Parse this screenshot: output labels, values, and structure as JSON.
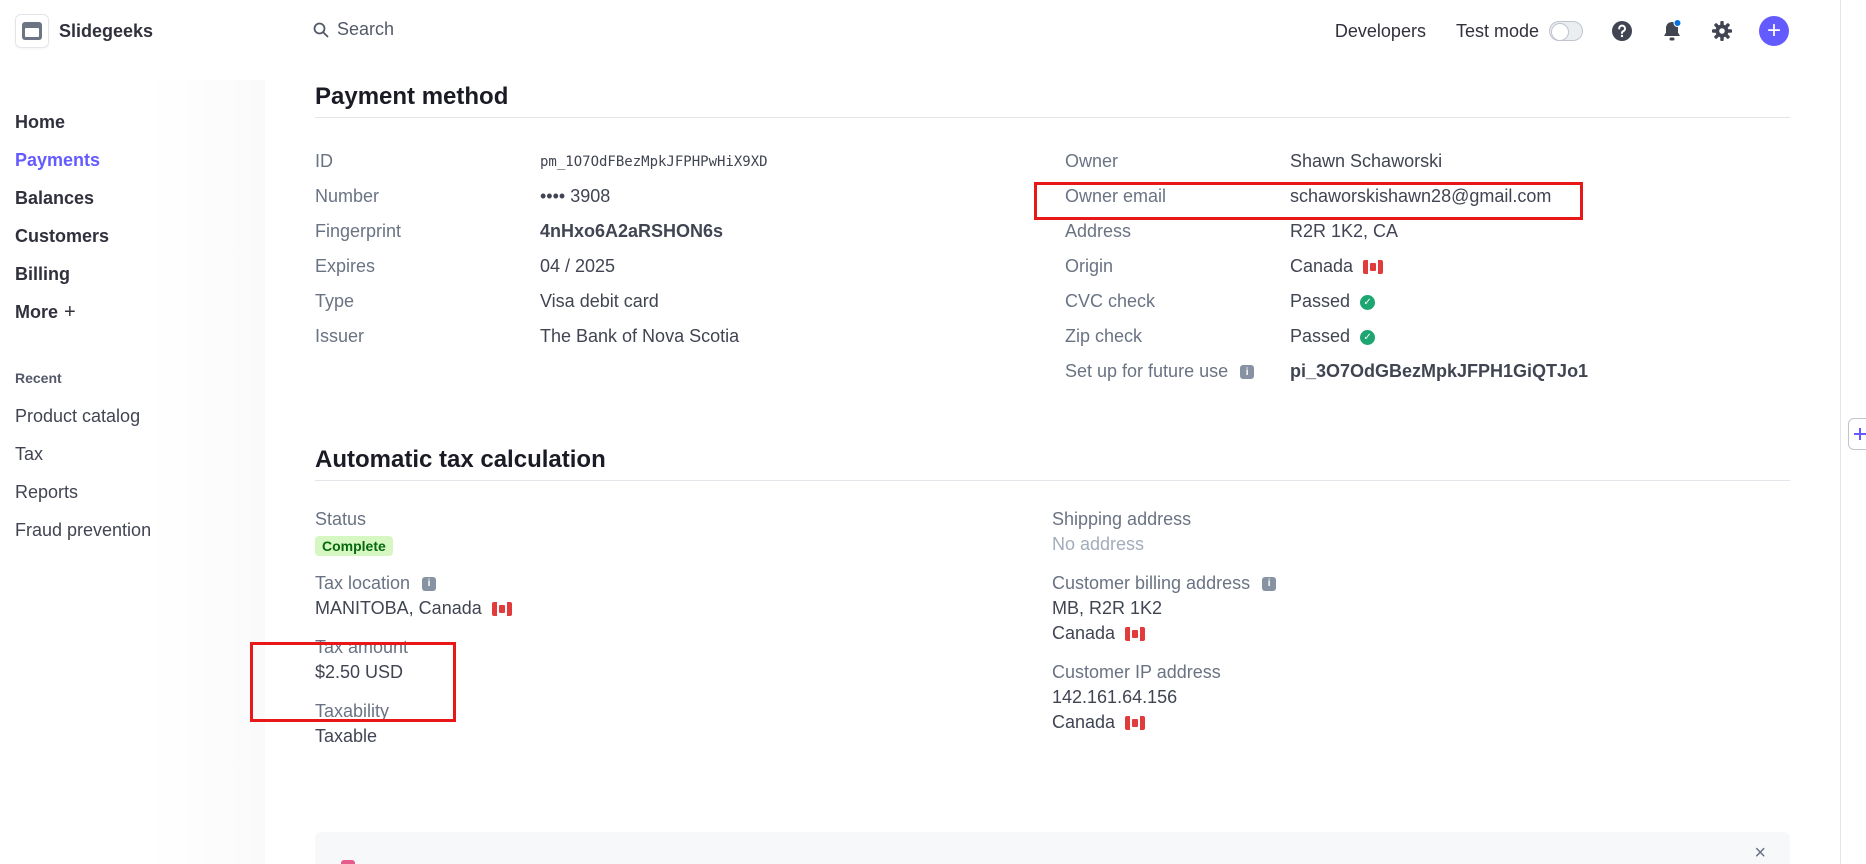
{
  "account": {
    "name": "Slidegeeks"
  },
  "nav": {
    "items": [
      {
        "label": "Home"
      },
      {
        "label": "Payments"
      },
      {
        "label": "Balances"
      },
      {
        "label": "Customers"
      },
      {
        "label": "Billing"
      },
      {
        "label": "More",
        "suffix": "+"
      }
    ],
    "recent_heading": "Recent",
    "recent": [
      {
        "label": "Product catalog"
      },
      {
        "label": "Tax"
      },
      {
        "label": "Reports"
      },
      {
        "label": "Fraud prevention"
      }
    ]
  },
  "topbar": {
    "search_placeholder": "Search",
    "developers": "Developers",
    "test_mode": "Test mode",
    "add_symbol": "+"
  },
  "payment_method": {
    "title": "Payment method",
    "left": [
      {
        "key": "ID",
        "value": "pm_1O7OdFBezMpkJFPHPwHiX9XD",
        "style": "mono"
      },
      {
        "key": "Number",
        "value": "•••• 3908",
        "style": "plain"
      },
      {
        "key": "Fingerprint",
        "value": "4nHxo6A2aRSHON6s",
        "style": "link"
      },
      {
        "key": "Expires",
        "value": "04 / 2025",
        "style": "plain"
      },
      {
        "key": "Type",
        "value": "Visa debit card",
        "style": "plain"
      },
      {
        "key": "Issuer",
        "value": "The Bank of Nova Scotia",
        "style": "plain"
      }
    ],
    "right": {
      "owner_label": "Owner",
      "owner_value": "Shawn Schaworski",
      "email_label": "Owner email",
      "email_value": "schaworskishawn28@gmail.com",
      "address_label": "Address",
      "address_value": "R2R 1K2, CA",
      "origin_label": "Origin",
      "origin_value": "Canada",
      "cvc_label": "CVC check",
      "cvc_value": "Passed",
      "zip_label": "Zip check",
      "zip_value": "Passed",
      "future_label": "Set up for future use",
      "future_value": "pi_3O7OdGBezMpkJFPH1GiQTJo1"
    }
  },
  "tax": {
    "title": "Automatic tax calculation",
    "status_label": "Status",
    "status_badge": "Complete",
    "location_label": "Tax location",
    "location_value": "MANITOBA, Canada",
    "amount_label": "Tax amount",
    "amount_value": "$2.50 USD",
    "taxability_label": "Taxability",
    "taxability_value": "Taxable",
    "shipping_label": "Shipping address",
    "shipping_value": "No address",
    "billing_label": "Customer billing address",
    "billing_line1": "MB, R2R 1K2",
    "billing_line2": "Canada",
    "ip_label": "Customer IP address",
    "ip_value": "142.161.64.156",
    "ip_country": "Canada"
  },
  "bottom_card": {
    "close_symbol": "×"
  },
  "colors": {
    "accent": "#635bff",
    "highlight": "#e81818",
    "success": "#1ea672"
  }
}
